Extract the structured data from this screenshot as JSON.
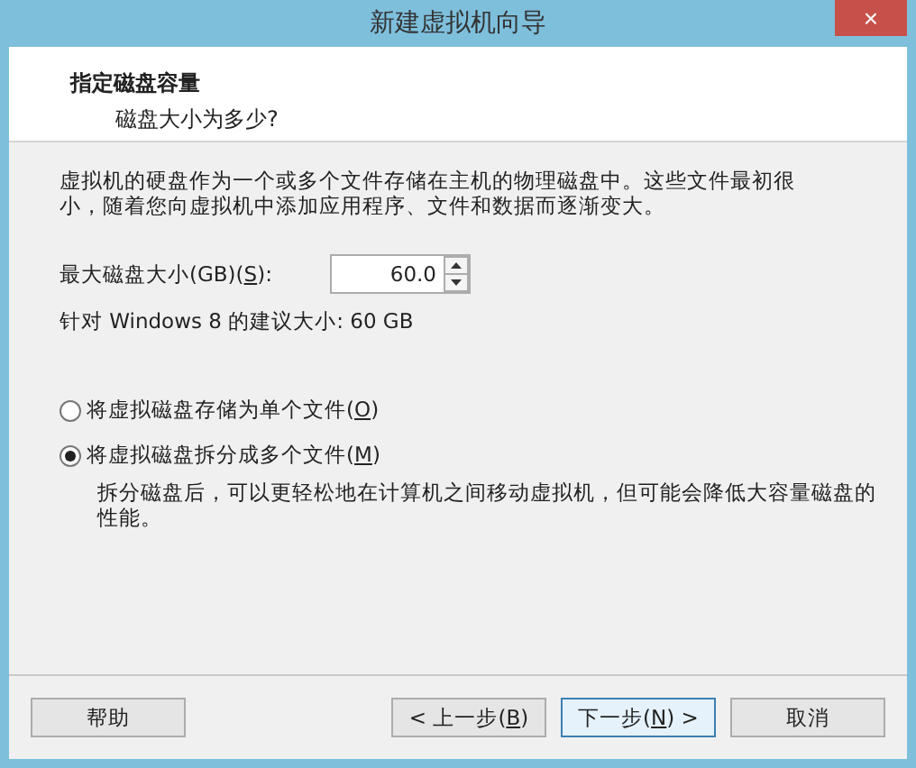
{
  "window": {
    "title": "新建虚拟机向导",
    "close": "×"
  },
  "header": {
    "title": "指定磁盘容量",
    "subtitle": "磁盘大小为多少?"
  },
  "description": "虚拟机的硬盘作为一个或多个文件存储在主机的物理磁盘中。这些文件最初很小，随着您向虚拟机中添加应用程序、文件和数据而逐渐变大。",
  "size_field": {
    "label": {
      "before": "最大磁盘大小(GB)(",
      "key": "S",
      "after": "):"
    },
    "value": "60.0"
  },
  "recommendation": "针对 Windows 8 的建议大小: 60 GB",
  "options": [
    {
      "label": {
        "before": "将虚拟磁盘存储为单个文件(",
        "key": "O",
        "after": ")"
      },
      "selected": false
    },
    {
      "label": {
        "before": "将虚拟磁盘拆分成多个文件(",
        "key": "M",
        "after": ")"
      },
      "selected": true,
      "note": "拆分磁盘后，可以更轻松地在计算机之间移动虚拟机，但可能会降低大容量磁盘的性能。"
    }
  ],
  "buttons": [
    {
      "kind": "help",
      "label": {
        "before": "帮助"
      }
    },
    {
      "kind": "back",
      "label": {
        "before": "< 上一步(",
        "key": "B",
        "after": ")"
      }
    },
    {
      "kind": "next",
      "label": {
        "before": "下一步(",
        "key": "N",
        "after": ") >"
      }
    },
    {
      "kind": "cancel",
      "label": {
        "before": "取消"
      }
    }
  ]
}
